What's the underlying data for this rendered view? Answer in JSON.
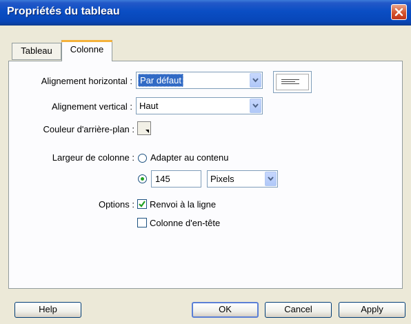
{
  "window": {
    "title": "Propriétés du tableau"
  },
  "tabs": [
    {
      "label": "Tableau",
      "active": false
    },
    {
      "label": "Colonne",
      "active": true
    }
  ],
  "fields": {
    "horizontal_align": {
      "label": "Alignement horizontal :",
      "value": "Par défaut"
    },
    "vertical_align": {
      "label": "Alignement vertical :",
      "value": "Haut"
    },
    "background_color": {
      "label": "Couleur d'arrière-plan :"
    },
    "column_width": {
      "label": "Largeur de colonne :",
      "option_fit": "Adapter au contenu",
      "fit_selected": false,
      "custom_selected": true,
      "value": "145",
      "unit": "Pixels"
    },
    "options": {
      "label": "Options :",
      "wrap_label": "Renvoi à la ligne",
      "wrap_checked": true,
      "header_label": "Colonne d'en-tête",
      "header_checked": false
    }
  },
  "buttons": {
    "help": "Help",
    "ok": "OK",
    "cancel": "Cancel",
    "apply": "Apply"
  },
  "colors": {
    "titlebar": "#0a4ec4",
    "face": "#ece9d8",
    "selection": "#316ac5",
    "check": "#21a121"
  }
}
